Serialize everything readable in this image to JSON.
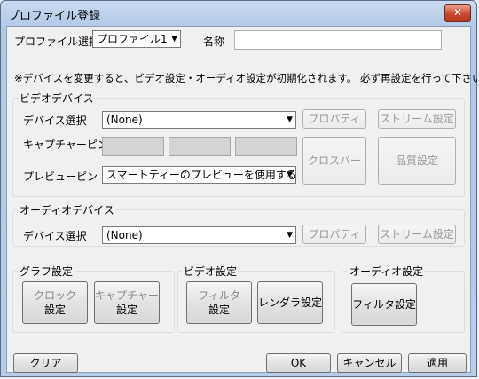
{
  "window": {
    "title": "プロファイル登録",
    "close_label": "✕"
  },
  "profile": {
    "select_label": "プロファイル選択",
    "select_value": "プロファイル1",
    "name_label": "名称",
    "name_value": ""
  },
  "notice": "※デバイスを変更すると、ビデオ設定・オーディオ設定が初期化されます。 必ず再設定を行って下さい。",
  "video": {
    "group_label": "ビデオデバイス",
    "device_label": "デバイス選択",
    "device_value": "(None)",
    "property_label": "プロパティ",
    "stream_label": "ストリーム設定",
    "capture_pin_label": "キャプチャーピン",
    "preview_pin_label": "プレビューピン",
    "preview_value": "スマートティーのプレビューを使用する",
    "crossbar_label": "クロスバー",
    "quality_label": "品質設定"
  },
  "audio": {
    "group_label": "オーディオデバイス",
    "device_label": "デバイス選択",
    "device_value": "(None)",
    "property_label": "プロパティ",
    "stream_label": "ストリーム設定"
  },
  "graph": {
    "group_label": "グラフ設定",
    "clock_l1": "クロック",
    "clock_l2": "設定",
    "capture_l1": "キャプチャー",
    "capture_l2": "設定"
  },
  "video_settings": {
    "group_label": "ビデオ設定",
    "filter_l1": "フィルタ",
    "filter_l2": "設定",
    "renderer_label": "レンダラ設定"
  },
  "audio_settings": {
    "group_label": "オーディオ設定",
    "filter_label": "フィルタ設定"
  },
  "footer": {
    "clear_label": "クリア",
    "ok_label": "OK",
    "cancel_label": "キャンセル",
    "apply_label": "適用"
  }
}
